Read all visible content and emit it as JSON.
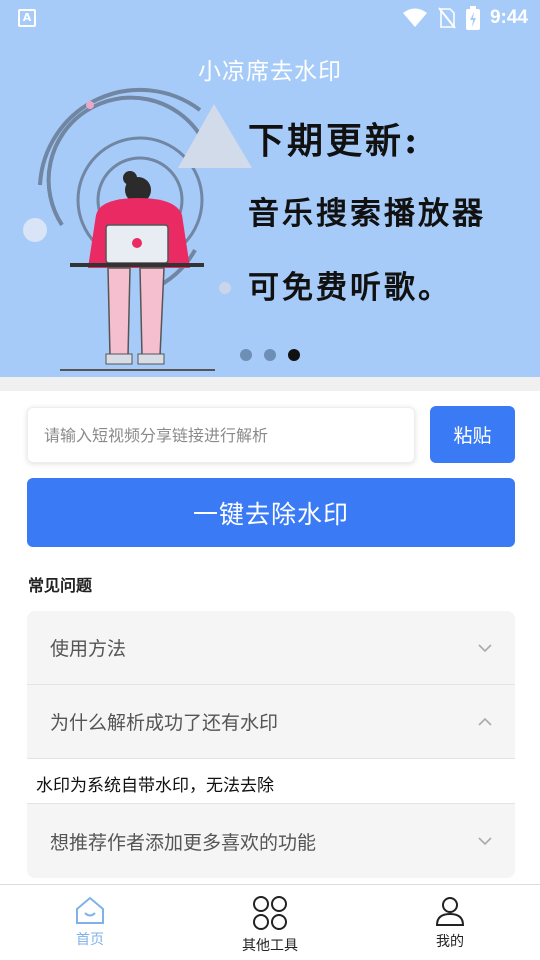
{
  "status_bar": {
    "time": "9:44",
    "app_icon_letter": "A"
  },
  "header": {
    "title": "小凉席去水印"
  },
  "banner": {
    "line1": "下期更新:",
    "line2": "音乐搜索播放器",
    "line3": "可免费听歌。",
    "active_slide": 3,
    "slide_count": 3
  },
  "input": {
    "placeholder": "请输入短视频分享链接进行解析",
    "value": ""
  },
  "paste_button": {
    "label": "粘贴"
  },
  "main_button": {
    "label": "一键去除水印"
  },
  "faq": {
    "title": "常见问题",
    "items": [
      {
        "question": "使用方法",
        "expanded": false
      },
      {
        "question": "为什么解析成功了还有水印",
        "expanded": true,
        "answer": "水印为系统自带水印，无法去除"
      },
      {
        "question": "想推荐作者添加更多喜欢的功能",
        "expanded": false
      }
    ]
  },
  "bottom_nav": {
    "items": [
      {
        "label": "首页",
        "icon": "home-icon",
        "active": true
      },
      {
        "label": "其他工具",
        "icon": "tools-icon",
        "active": false
      },
      {
        "label": "我的",
        "icon": "user-icon",
        "active": false
      }
    ]
  },
  "colors": {
    "primary": "#3a7bf5",
    "banner_bg": "#a6cbf8",
    "active_tab": "#7fb2ea"
  }
}
